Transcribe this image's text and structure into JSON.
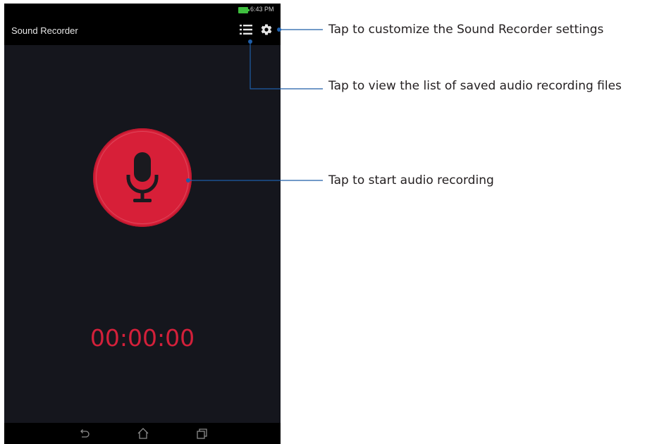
{
  "status_bar": {
    "time": "6:43 PM",
    "battery_color": "#3fbf3f"
  },
  "app": {
    "title": "Sound Recorder",
    "list_icon": "list-icon",
    "settings_icon": "gear-icon"
  },
  "recorder": {
    "button_color": "#d71f38",
    "icon": "microphone-icon",
    "timer": "00:00:00",
    "timer_color": "#d3203a"
  },
  "nav_bar": {
    "back_icon": "back-icon",
    "home_icon": "home-icon",
    "recents_icon": "recents-icon"
  },
  "callouts": {
    "settings": "Tap to customize the Sound Recorder settings",
    "list": "Tap to view the list of saved audio recording files",
    "record": "Tap to start audio recording",
    "line_color": "#1f5ea8"
  }
}
